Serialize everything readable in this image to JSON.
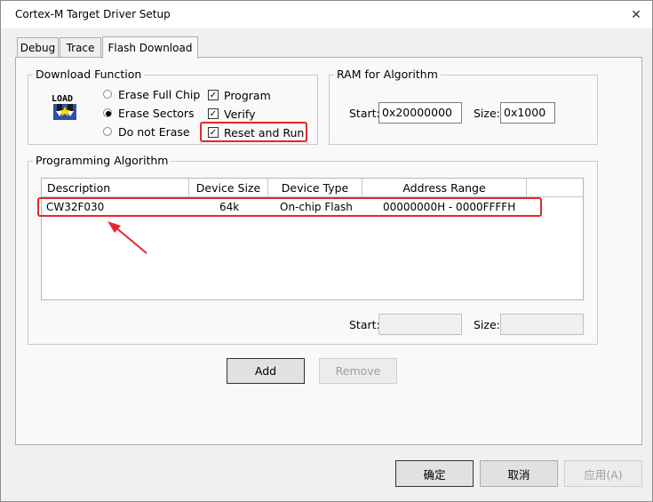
{
  "window": {
    "title": "Cortex-M Target Driver Setup",
    "close_glyph": "✕"
  },
  "tabs": [
    {
      "label": "Debug"
    },
    {
      "label": "Trace"
    },
    {
      "label": "Flash Download"
    }
  ],
  "download_function": {
    "label": "Download Function",
    "icon_text": "LOAD",
    "radios": [
      {
        "label": "Erase Full Chip",
        "checked": false
      },
      {
        "label": "Erase Sectors",
        "checked": true
      },
      {
        "label": "Do not Erase",
        "checked": false
      }
    ],
    "checks": [
      {
        "label": "Program",
        "checked": true
      },
      {
        "label": "Verify",
        "checked": true
      },
      {
        "label": "Reset and Run",
        "checked": true
      }
    ]
  },
  "ram": {
    "label": "RAM for Algorithm",
    "start_label": "Start:",
    "start_value": "0x20000000",
    "size_label": "Size:",
    "size_value": "0x1000"
  },
  "programming": {
    "label": "Programming Algorithm",
    "columns": [
      "Description",
      "Device Size",
      "Device Type",
      "Address Range"
    ],
    "rows": [
      {
        "description": "CW32F030",
        "size": "64k",
        "type": "On-chip Flash",
        "range": "00000000H - 0000FFFFH"
      }
    ],
    "start_label": "Start:",
    "start_value": "",
    "size_label": "Size:",
    "size_value": ""
  },
  "buttons": {
    "add": "Add",
    "remove": "Remove",
    "ok": "确定",
    "cancel": "取消",
    "apply": "应用(A)"
  },
  "colors": {
    "annotation": "#e8262a",
    "window_bg": "#f0f0f0",
    "panel_bg": "#f9f9f9"
  },
  "check_glyph": "✓"
}
